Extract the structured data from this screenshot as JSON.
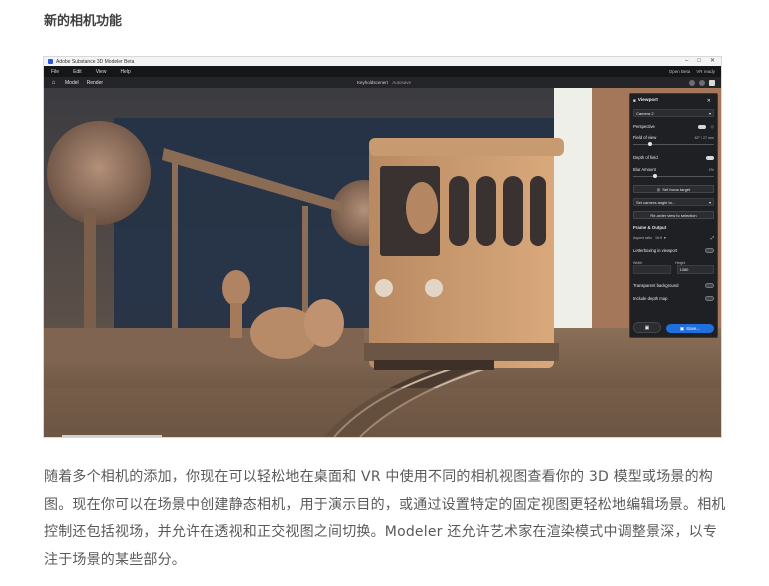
{
  "heading": "新的相机功能",
  "app": {
    "window_title": "Adobe Substance 3D Modeler Beta",
    "window_buttons": [
      "–",
      "□",
      "✕"
    ],
    "menu": [
      "File",
      "Edit",
      "View",
      "Help"
    ],
    "menubar_right": [
      "Open Beta",
      "VR ready"
    ],
    "toolbar": {
      "home_icon": "⌂",
      "modes": [
        "Model",
        "Render"
      ],
      "document_name": "Keyholdscenert",
      "document_status": "Autosave"
    }
  },
  "panel": {
    "title": "Viewport",
    "close": "✕",
    "camera_select": "Camera 2",
    "perspective_label": "Perspective",
    "field_of_view_label": "Field of view",
    "field_of_view_value": "62° / 27 mm",
    "field_of_view_level": 0.18,
    "depth_of_field_label": "Depth of field",
    "blur_amount_label": "Blur Amount",
    "blur_amount_value": "2%",
    "blur_amount_level": 0.25,
    "set_focus_target": "Set focus target",
    "set_camera_angle": "Set camera angle to...",
    "reorder_view": "Re-order view to selection",
    "frame_output_label": "Frame & Output",
    "aspect_ratio_label": "Aspect ratio",
    "aspect_ratio_value": "16:9",
    "letterboxing_label": "Letterboxing in viewport",
    "width_label": "Width",
    "height_label": "Height",
    "height_value": "1080",
    "transparent_bg_label": "Transparent background",
    "include_depth_label": "Include depth map",
    "save_label": "Save..."
  },
  "body_text": "随着多个相机的添加，你现在可以轻松地在桌面和 VR 中使用不同的相机视图查看你的 3D 模型或场景的构图。现在你可以在场景中创建静态相机，用于演示目的，或通过设置特定的固定视图更轻松地编辑场景。相机控制还包括视场，并允许在透视和正交视图之间切换。Modeler 还允许艺术家在渲染模式中调整景深，以专注于场景的某些部分。"
}
